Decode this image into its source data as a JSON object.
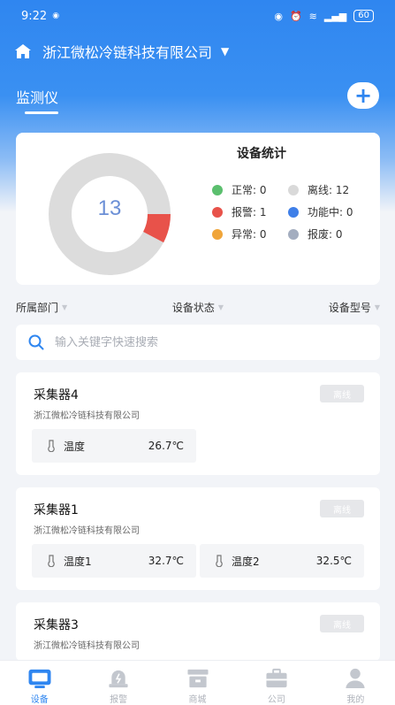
{
  "status_bar": {
    "time": "9:22",
    "battery": "60"
  },
  "header": {
    "company": "浙江微松冷链科技有限公司"
  },
  "tab": {
    "title": "监测仪"
  },
  "stats": {
    "title": "设备统计",
    "total": "13",
    "legend": [
      {
        "label": "正常: 0",
        "color": "#5bbf6e"
      },
      {
        "label": "离线: 12",
        "color": "#d9d9d9"
      },
      {
        "label": "报警: 1",
        "color": "#e8524a"
      },
      {
        "label": "功能中: 0",
        "color": "#3f7fe8"
      },
      {
        "label": "异常: 0",
        "color": "#f0a53a"
      },
      {
        "label": "报废: 0",
        "color": "#a3adbf"
      }
    ],
    "donut": {
      "offline": 12,
      "alarm": 1
    }
  },
  "filters": {
    "department": "所属部门",
    "status": "设备状态",
    "model": "设备型号"
  },
  "search": {
    "placeholder": "输入关键字快速搜索"
  },
  "devices": [
    {
      "name": "采集器4",
      "company": "浙江微松冷链科技有限公司",
      "status": "离线",
      "readings": [
        {
          "label": "温度",
          "value": "26.7℃"
        }
      ]
    },
    {
      "name": "采集器1",
      "company": "浙江微松冷链科技有限公司",
      "status": "离线",
      "readings": [
        {
          "label": "温度1",
          "value": "32.7℃"
        },
        {
          "label": "温度2",
          "value": "32.5℃"
        }
      ]
    },
    {
      "name": "采集器3",
      "company": "浙江微松冷链科技有限公司",
      "status": "离线",
      "readings": []
    }
  ],
  "tabbar": [
    {
      "label": "设备",
      "icon": "device-icon"
    },
    {
      "label": "报警",
      "icon": "alarm-icon"
    },
    {
      "label": "商城",
      "icon": "store-icon"
    },
    {
      "label": "公司",
      "icon": "company-icon"
    },
    {
      "label": "我的",
      "icon": "user-icon"
    }
  ]
}
